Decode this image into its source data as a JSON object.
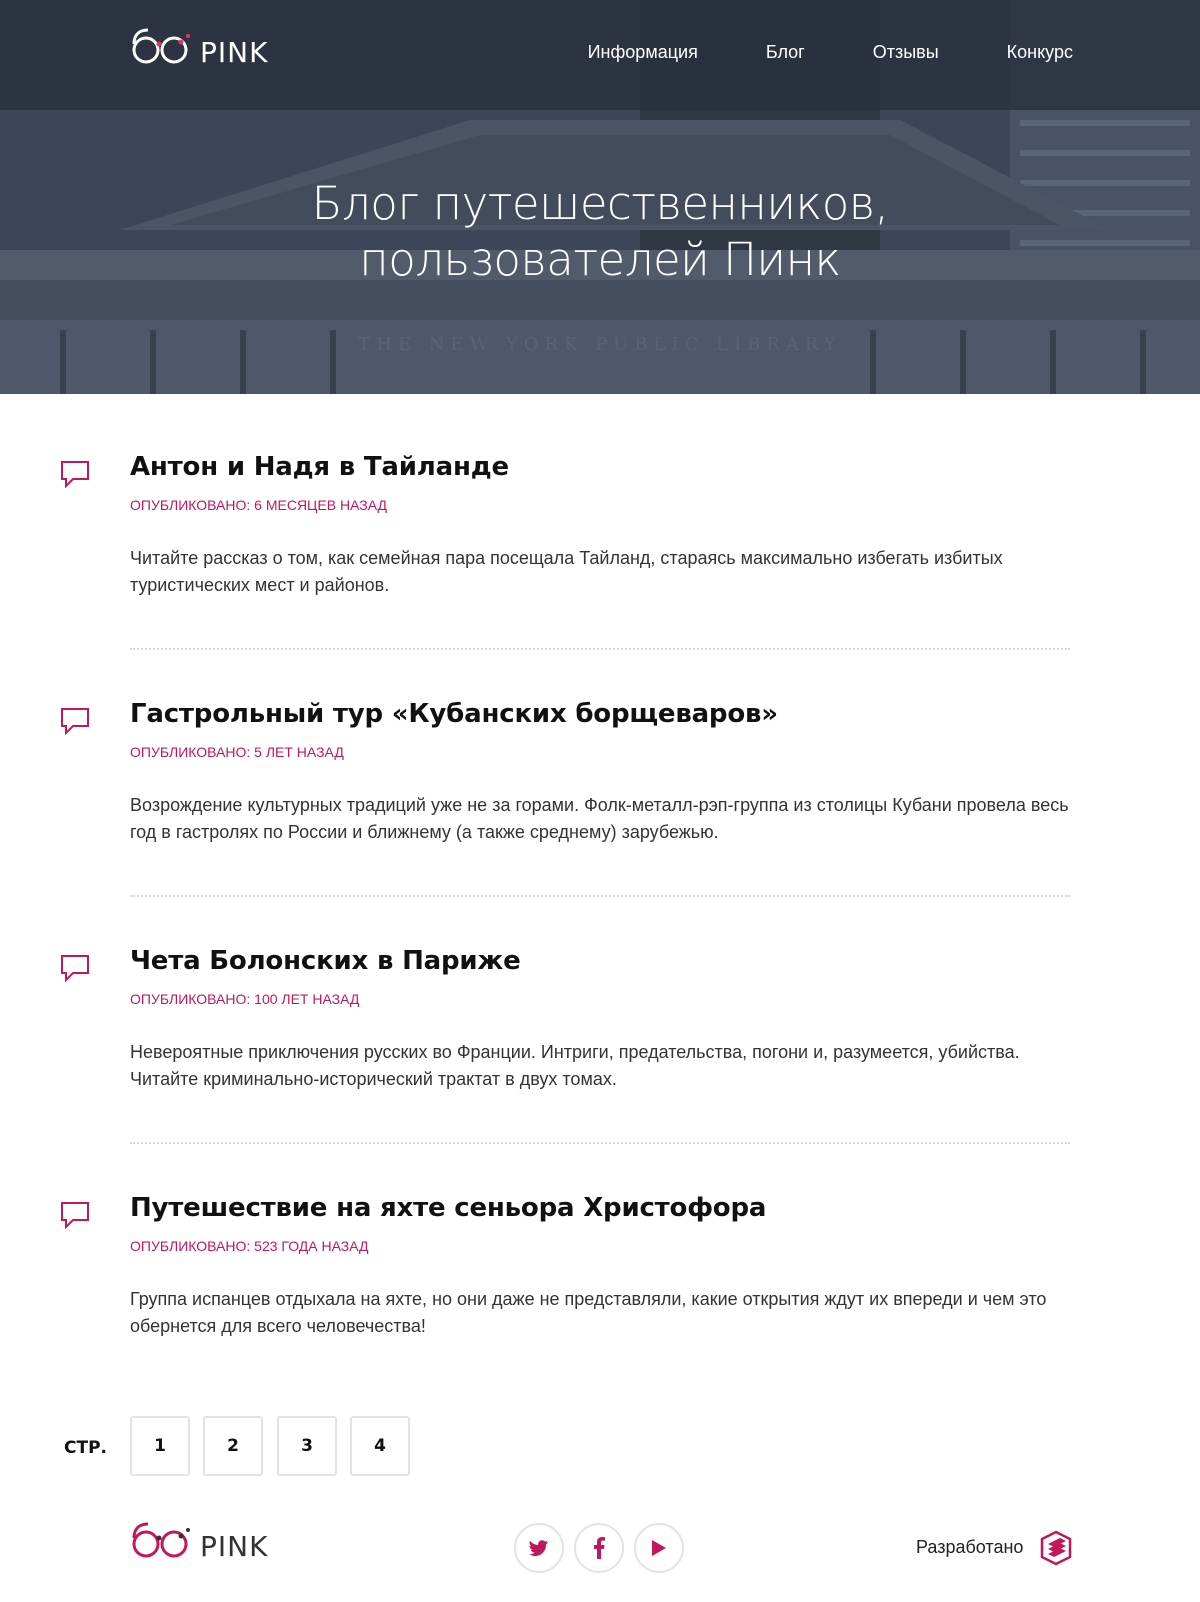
{
  "brand": {
    "logo_text": "PINK",
    "accent": "#c2185b"
  },
  "nav": {
    "items": [
      {
        "label": "Информация"
      },
      {
        "label": "Блог"
      },
      {
        "label": "Отзывы"
      },
      {
        "label": "Конкурс"
      }
    ]
  },
  "hero": {
    "title_line1": "Блог путешественников,",
    "title_line2": "пользователей Пинк",
    "bg_text": "THE NEW YORK PUBLIC LIBRARY"
  },
  "posts": [
    {
      "title": "Антон и Надя в Тайланде",
      "date": "ОПУБЛИКОВАНО: 6 МЕСЯЦЕВ НАЗАД",
      "text": "Читайте рассказ о том, как семейная пара посещала Тайланд, стараясь максимально избегать избитых туристических мест и районов.",
      "icon": "comment-icon"
    },
    {
      "title": "Гастрольный тур «Кубанских борщеваров»",
      "date": "ОПУБЛИКОВАНО: 5 ЛЕТ НАЗАД",
      "text": "Возрождение культурных традиций уже не за горами. Фолк-металл-рэп-группа из столицы Кубани провела весь год в гастролях по России и ближнему (а также среднему) зарубежью.",
      "icon": "comment-icon"
    },
    {
      "title": "Чета Болонских в Париже",
      "date": "ОПУБЛИКОВАНО: 100 ЛЕТ НАЗАД",
      "text": "Невероятные приключения русских во Франции. Интриги, предательства, погони и, разумеется, убийства. Читайте криминально-исторический трактат в двух томах.",
      "icon": "comment-icon"
    },
    {
      "title": "Путешествие на яхте сеньора Христофора",
      "date": "ОПУБЛИКОВАНО: 523 ГОДА НАЗАД",
      "text": "Группа испанцев отдыхала на яхте, но они даже не представляли, какие открытия ждут их впереди и чем это обернется для всего человечества!",
      "icon": "comment-icon"
    }
  ],
  "pagination": {
    "label": "СТР.",
    "pages": [
      "1",
      "2",
      "3",
      "4"
    ]
  },
  "footer": {
    "logo_text": "PINK",
    "social": [
      {
        "icon": "twitter-icon"
      },
      {
        "icon": "facebook-icon"
      },
      {
        "icon": "youtube-icon"
      }
    ],
    "developed_label": "Разработано",
    "developer_icon": "htmlacademy-icon"
  }
}
